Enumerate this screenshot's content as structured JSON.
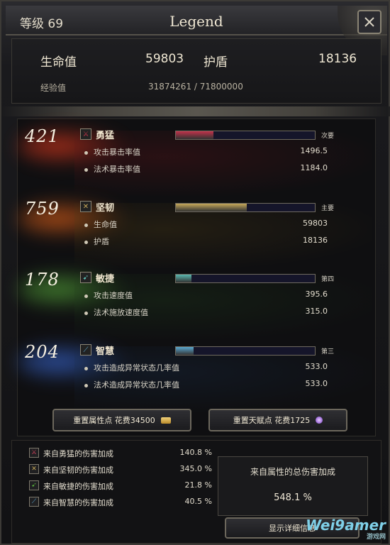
{
  "header": {
    "level": "等级 69",
    "name": "Legend",
    "life_label": "生命值",
    "life_value": "59803",
    "shield_label": "护盾",
    "shield_value": "18136",
    "exp_label": "经验值",
    "exp_value": "31874261 / 71800000"
  },
  "attributes": [
    {
      "value": "421",
      "name": "勇猛",
      "icon": "sword-icon",
      "rank": "次要",
      "bar_fraction": 0.27,
      "bar_color": "#c2324a",
      "glow_color": "#e23a1e",
      "texture_color": "#5a1418",
      "stats": [
        {
          "label": "攻击暴击率值",
          "value": "1496.5"
        },
        {
          "label": "法术暴击率值",
          "value": "1184.0"
        }
      ]
    },
    {
      "value": "759",
      "name": "坚韧",
      "icon": "shield-icon",
      "rank": "主要",
      "bar_fraction": 0.51,
      "bar_color": "#c7a85a",
      "glow_color": "#e8641a",
      "texture_color": "#4a3a14",
      "stats": [
        {
          "label": "生命值",
          "value": "59803"
        },
        {
          "label": "护盾",
          "value": "18136"
        }
      ]
    },
    {
      "value": "178",
      "name": "敏捷",
      "icon": "bow-icon",
      "rank": "第四",
      "bar_fraction": 0.11,
      "bar_color": "#5ab8b0",
      "glow_color": "#56a83a",
      "texture_color": "#1e3a1a",
      "stats": [
        {
          "label": "攻击速度值",
          "value": "395.6"
        },
        {
          "label": "法术施放速度值",
          "value": "315.0"
        }
      ]
    },
    {
      "value": "204",
      "name": "智慧",
      "icon": "staff-icon",
      "rank": "第三",
      "bar_fraction": 0.13,
      "bar_color": "#5aa8d0",
      "glow_color": "#3a6ad8",
      "texture_color": "#182a44",
      "stats": [
        {
          "label": "攻击造成异常状态几率值",
          "value": "533.0"
        },
        {
          "label": "法术造成异常状态几率值",
          "value": "533.0"
        }
      ]
    }
  ],
  "buttons": {
    "reset_attr": "重置属性点 花费34500",
    "reset_talent": "重置天赋点 花费1725",
    "show_detail": "显示详细信息"
  },
  "bonuses": [
    {
      "label": "来自勇猛的伤害加成",
      "value": "140.8 %",
      "icon_color": "#d0405a"
    },
    {
      "label": "来自坚韧的伤害加成",
      "value": "345.0 %",
      "icon_color": "#c7a85a"
    },
    {
      "label": "来自敏捷的伤害加成",
      "value": "21.8 %",
      "icon_color": "#56a83a"
    },
    {
      "label": "来自智慧的伤害加成",
      "value": "40.5 %",
      "icon_color": "#5aa8d0"
    }
  ],
  "total": {
    "label": "来自属性的总伤害加成",
    "value": "548.1 %"
  },
  "watermark": {
    "main": "Wei9amer",
    "sub": "游戏网"
  }
}
